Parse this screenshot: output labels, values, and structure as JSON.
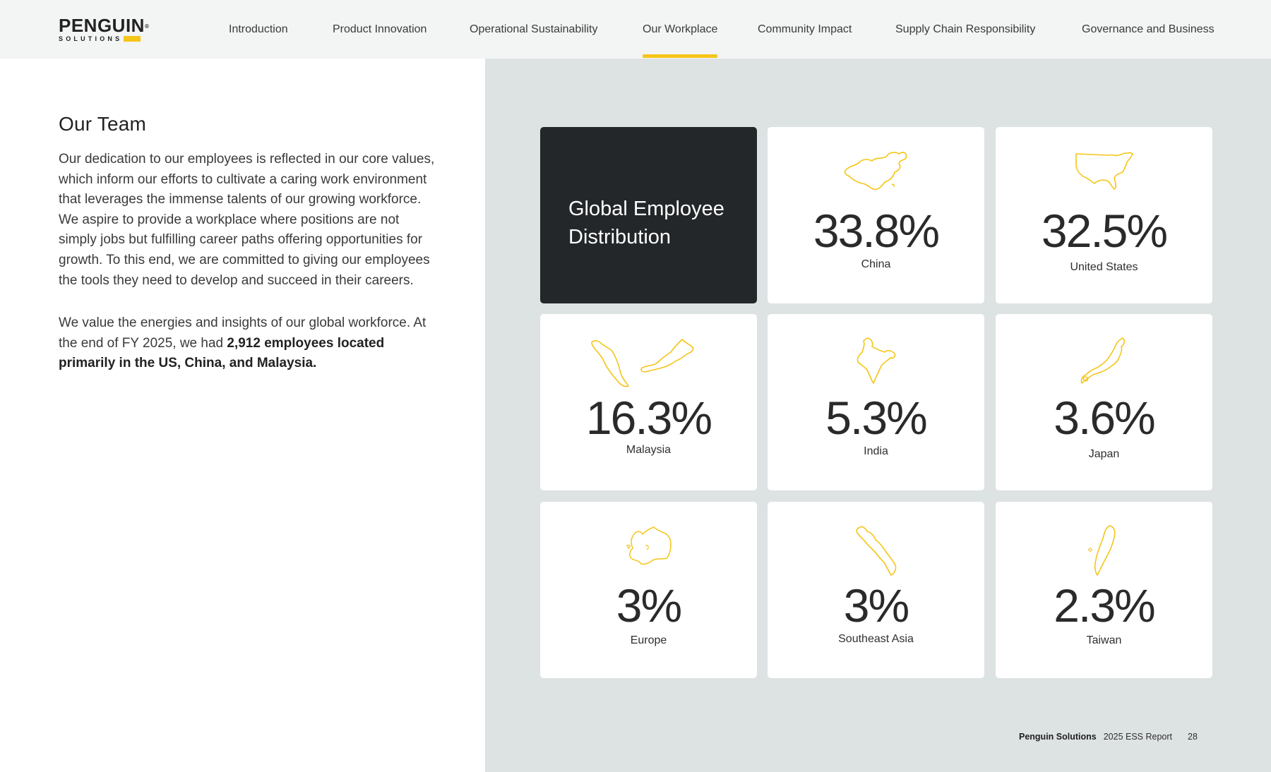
{
  "logo": {
    "main": "PENGUIN",
    "mark": "®",
    "sub": "SOLUTIONS"
  },
  "nav": [
    {
      "label": "Introduction"
    },
    {
      "label": "Product Innovation"
    },
    {
      "label": "Operational Sustainability"
    },
    {
      "label": "Our Workplace",
      "active": true
    },
    {
      "label": "Community Impact"
    },
    {
      "label": "Supply Chain Responsibility"
    },
    {
      "label": "Governance and Business"
    }
  ],
  "section": {
    "title": "Our Team",
    "para1": "Our dedication to our employees is reflected in our core values, which inform our efforts to cultivate a caring work environment that leverages the immense talents of our growing workforce. We aspire to provide a workplace where positions are not simply jobs but fulfilling career paths offering opportunities for growth. To this end, we are committed to giving our employees the tools they need to develop and succeed in their careers.",
    "para2_plain": "We value the energies and insights of our global workforce. At the end of FY 2025, we had ",
    "para2_bold": "2,912 employees located primarily in the US, China, and Malaysia."
  },
  "distribution": {
    "title": "Global Employee Distribution",
    "items": [
      {
        "region": "China",
        "percent": "33.8%",
        "icon": "china-map-icon"
      },
      {
        "region": "United States",
        "percent": "32.5%",
        "icon": "usa-map-icon"
      },
      {
        "region": "Malaysia",
        "percent": "16.3%",
        "icon": "malaysia-map-icon"
      },
      {
        "region": "India",
        "percent": "5.3%",
        "icon": "india-map-icon"
      },
      {
        "region": "Japan",
        "percent": "3.6%",
        "icon": "japan-map-icon"
      },
      {
        "region": "Europe",
        "percent": "3%",
        "icon": "europe-map-icon"
      },
      {
        "region": "Southeast Asia",
        "percent": "3%",
        "icon": "southeast-asia-map-icon"
      },
      {
        "region": "Taiwan",
        "percent": "2.3%",
        "icon": "taiwan-map-icon"
      }
    ],
    "accent": "#f5c518",
    "dark_card": "#23272a"
  },
  "footer": {
    "brand": "Penguin Solutions",
    "report": "2025 ESS Report",
    "page": "28"
  }
}
